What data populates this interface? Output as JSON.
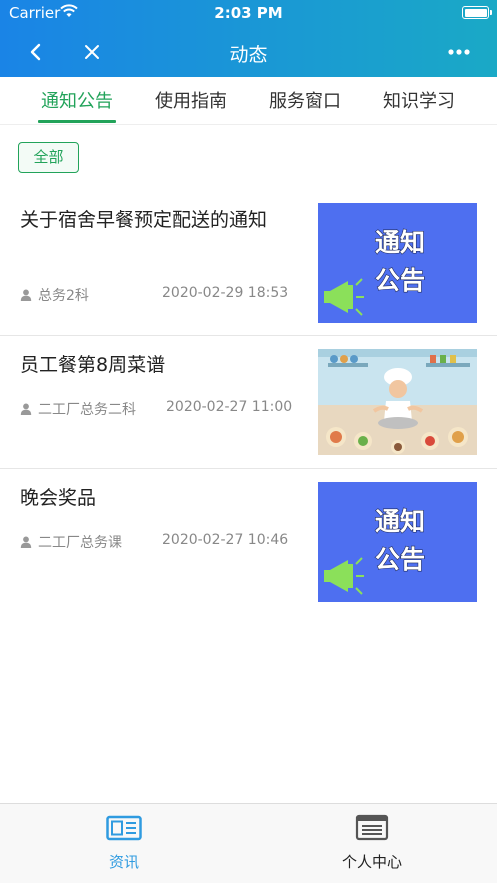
{
  "status_bar": {
    "carrier": "Carrier",
    "time": "2:03 PM"
  },
  "nav": {
    "title": "动态"
  },
  "tabs": [
    {
      "label": "通知公告",
      "active": true
    },
    {
      "label": "使用指南",
      "active": false
    },
    {
      "label": "服务窗口",
      "active": false
    },
    {
      "label": "知识学习",
      "active": false
    }
  ],
  "filter": {
    "label": "全部"
  },
  "items": [
    {
      "title": "关于宿舍早餐预定配送的通知",
      "author": "总务2科",
      "date": "2020-02-29 18:53",
      "thumb": "notice",
      "thumb_text_1": "通知",
      "thumb_text_2": "公告"
    },
    {
      "title": "员工餐第8周菜谱",
      "author": "二工厂总务二科",
      "date": "2020-02-27 11:00",
      "thumb": "chef"
    },
    {
      "title": "晚会奖品",
      "author": "二工厂总务课",
      "date": "2020-02-27 10:46",
      "thumb": "notice",
      "thumb_text_1": "通知",
      "thumb_text_2": "公告"
    }
  ],
  "tabbar": [
    {
      "label": "资讯",
      "active": true
    },
    {
      "label": "个人中心",
      "active": false
    }
  ],
  "colors": {
    "accent": "#22a35a",
    "header_start": "#1a84e6",
    "header_end": "#1aa9c6",
    "notice_bg": "#4e6ff0",
    "tabbar_active": "#2f9be0"
  }
}
